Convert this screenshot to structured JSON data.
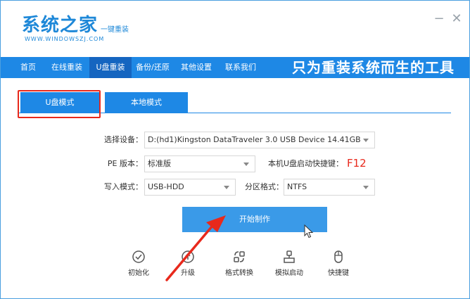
{
  "app": {
    "logo_main": "系统之家",
    "logo_suffix": "一键重装",
    "logo_url": "WWW.WINDOWSZJ.COM",
    "window_controls": {
      "minimize": "−",
      "close": "✕"
    }
  },
  "nav": {
    "items": [
      {
        "label": "首页"
      },
      {
        "label": "在线重装"
      },
      {
        "label": "U盘重装"
      },
      {
        "label": "备份/还原"
      },
      {
        "label": "其他设置"
      },
      {
        "label": "联系我们"
      }
    ],
    "active": "U盘重装",
    "slogan": "只为重装系统而生的工具"
  },
  "tabs": [
    {
      "label": "U盘模式"
    },
    {
      "label": "本地模式"
    }
  ],
  "form": {
    "device_label": "选择设备：",
    "device_value": "D:(hd1)Kingston DataTraveler 3.0 USB Device 14.41GB",
    "pe_label": "PE 版本：",
    "pe_value": "标准版",
    "hotkey_label": "本机U盘启动快捷键：",
    "hotkey_value": "F12",
    "write_label": "写入模式：",
    "write_value": "USB-HDD",
    "partition_label": "分区格式：",
    "partition_value": "NTFS"
  },
  "start_button": "开始制作",
  "tools": [
    {
      "label": "初始化",
      "icon": "check-circle-icon"
    },
    {
      "label": "升级",
      "icon": "upgrade-icon"
    },
    {
      "label": "格式转换",
      "icon": "convert-icon"
    },
    {
      "label": "模拟启动",
      "icon": "simulate-boot-icon"
    },
    {
      "label": "快捷键",
      "icon": "mouse-icon"
    }
  ],
  "colors": {
    "primary": "#1e88e5",
    "active_nav": "#1565c0",
    "accent_red": "#e8291c",
    "button": "#3a9ae8"
  }
}
